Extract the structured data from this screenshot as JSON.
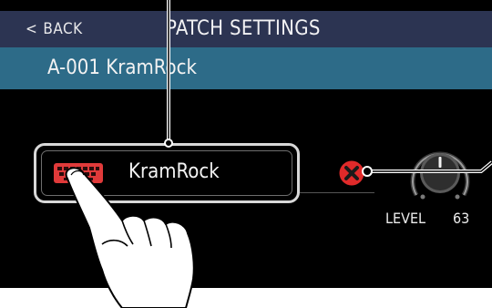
{
  "header": {
    "back_chevron": "<",
    "back_label": "BACK",
    "title": "PATCH SETTINGS"
  },
  "patch": {
    "current": "A-001 KramRock"
  },
  "name_field": {
    "value": "KramRock",
    "icon": "keyboard-icon"
  },
  "clear_button": {
    "icon": "close-circle-icon"
  },
  "level": {
    "label": "LEVEL",
    "value": "63"
  },
  "colors": {
    "titlebar": "#2c3452",
    "patchbar": "#2d6b88",
    "keyboard_icon": "#e03a3a",
    "clear_icon": "#e02a2a"
  }
}
